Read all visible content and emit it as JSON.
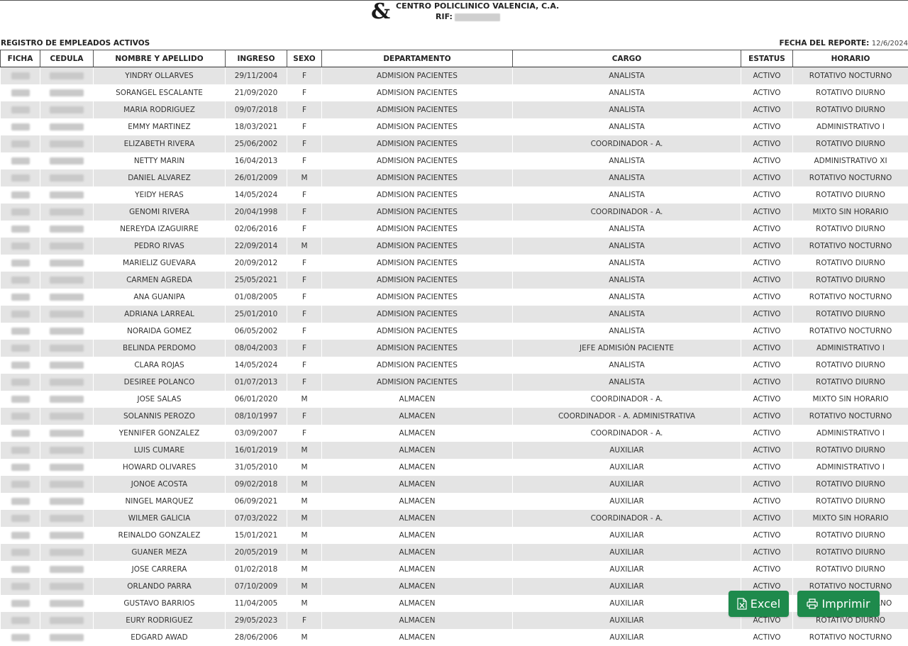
{
  "header": {
    "company": "CENTRO POLICLINICO VALENCIA, C.A.",
    "rif_label": "RIF:",
    "subtitle": "REGISTRO DE EMPLEADOS ACTIVOS",
    "report_date_label": "FECHA DEL REPORTE:",
    "report_date_value": "12/6/2024"
  },
  "table": {
    "columns": [
      "FICHA",
      "CEDULA",
      "NOMBRE Y APELLIDO",
      "INGRESO",
      "SEXO",
      "DEPARTAMENTO",
      "CARGO",
      "ESTATUS",
      "HORARIO"
    ],
    "rows": [
      {
        "nombre": "YINDRY OLLARVES",
        "ingreso": "29/11/2004",
        "sexo": "F",
        "departamento": "ADMISION PACIENTES",
        "cargo": "ANALISTA",
        "estatus": "ACTIVO",
        "horario": "ROTATIVO NOCTURNO"
      },
      {
        "nombre": "SORANGEL ESCALANTE",
        "ingreso": "21/09/2020",
        "sexo": "F",
        "departamento": "ADMISION PACIENTES",
        "cargo": "ANALISTA",
        "estatus": "ACTIVO",
        "horario": "ROTATIVO DIURNO"
      },
      {
        "nombre": "MARIA RODRIGUEZ",
        "ingreso": "09/07/2018",
        "sexo": "F",
        "departamento": "ADMISION PACIENTES",
        "cargo": "ANALISTA",
        "estatus": "ACTIVO",
        "horario": "ROTATIVO DIURNO"
      },
      {
        "nombre": "EMMY MARTINEZ",
        "ingreso": "18/03/2021",
        "sexo": "F",
        "departamento": "ADMISION PACIENTES",
        "cargo": "ANALISTA",
        "estatus": "ACTIVO",
        "horario": "ADMINISTRATIVO I"
      },
      {
        "nombre": "ELIZABETH RIVERA",
        "ingreso": "25/06/2002",
        "sexo": "F",
        "departamento": "ADMISION PACIENTES",
        "cargo": "COORDINADOR - A.",
        "estatus": "ACTIVO",
        "horario": "ROTATIVO DIURNO"
      },
      {
        "nombre": "NETTY MARIN",
        "ingreso": "16/04/2013",
        "sexo": "F",
        "departamento": "ADMISION PACIENTES",
        "cargo": "ANALISTA",
        "estatus": "ACTIVO",
        "horario": "ADMINISTRATIVO XI"
      },
      {
        "nombre": "DANIEL ALVAREZ",
        "ingreso": "26/01/2009",
        "sexo": "M",
        "departamento": "ADMISION PACIENTES",
        "cargo": "ANALISTA",
        "estatus": "ACTIVO",
        "horario": "ROTATIVO NOCTURNO"
      },
      {
        "nombre": "YEIDY HERAS",
        "ingreso": "14/05/2024",
        "sexo": "F",
        "departamento": "ADMISION PACIENTES",
        "cargo": "ANALISTA",
        "estatus": "ACTIVO",
        "horario": "ROTATIVO DIURNO"
      },
      {
        "nombre": "GENOMI RIVERA",
        "ingreso": "20/04/1998",
        "sexo": "F",
        "departamento": "ADMISION PACIENTES",
        "cargo": "COORDINADOR - A.",
        "estatus": "ACTIVO",
        "horario": "MIXTO SIN HORARIO"
      },
      {
        "nombre": "NEREYDA IZAGUIRRE",
        "ingreso": "02/06/2016",
        "sexo": "F",
        "departamento": "ADMISION PACIENTES",
        "cargo": "ANALISTA",
        "estatus": "ACTIVO",
        "horario": "ROTATIVO DIURNO"
      },
      {
        "nombre": "PEDRO RIVAS",
        "ingreso": "22/09/2014",
        "sexo": "M",
        "departamento": "ADMISION PACIENTES",
        "cargo": "ANALISTA",
        "estatus": "ACTIVO",
        "horario": "ROTATIVO NOCTURNO"
      },
      {
        "nombre": "MARIELIZ GUEVARA",
        "ingreso": "20/09/2012",
        "sexo": "F",
        "departamento": "ADMISION PACIENTES",
        "cargo": "ANALISTA",
        "estatus": "ACTIVO",
        "horario": "ROTATIVO DIURNO"
      },
      {
        "nombre": "CARMEN AGREDA",
        "ingreso": "25/05/2021",
        "sexo": "F",
        "departamento": "ADMISION PACIENTES",
        "cargo": "ANALISTA",
        "estatus": "ACTIVO",
        "horario": "ROTATIVO DIURNO"
      },
      {
        "nombre": "ANA GUANIPA",
        "ingreso": "01/08/2005",
        "sexo": "F",
        "departamento": "ADMISION PACIENTES",
        "cargo": "ANALISTA",
        "estatus": "ACTIVO",
        "horario": "ROTATIVO NOCTURNO"
      },
      {
        "nombre": "ADRIANA LARREAL",
        "ingreso": "25/01/2010",
        "sexo": "F",
        "departamento": "ADMISION PACIENTES",
        "cargo": "ANALISTA",
        "estatus": "ACTIVO",
        "horario": "ROTATIVO DIURNO"
      },
      {
        "nombre": "NORAIDA GOMEZ",
        "ingreso": "06/05/2002",
        "sexo": "F",
        "departamento": "ADMISION PACIENTES",
        "cargo": "ANALISTA",
        "estatus": "ACTIVO",
        "horario": "ROTATIVO NOCTURNO"
      },
      {
        "nombre": "BELINDA PERDOMO",
        "ingreso": "08/04/2003",
        "sexo": "F",
        "departamento": "ADMISION PACIENTES",
        "cargo": "JEFE ADMISIÓN PACIENTE",
        "estatus": "ACTIVO",
        "horario": "ADMINISTRATIVO I"
      },
      {
        "nombre": "CLARA ROJAS",
        "ingreso": "14/05/2024",
        "sexo": "F",
        "departamento": "ADMISION PACIENTES",
        "cargo": "ANALISTA",
        "estatus": "ACTIVO",
        "horario": "ROTATIVO DIURNO"
      },
      {
        "nombre": "DESIREE POLANCO",
        "ingreso": "01/07/2013",
        "sexo": "F",
        "departamento": "ADMISION PACIENTES",
        "cargo": "ANALISTA",
        "estatus": "ACTIVO",
        "horario": "ROTATIVO DIURNO"
      },
      {
        "nombre": "JOSE SALAS",
        "ingreso": "06/01/2020",
        "sexo": "M",
        "departamento": "ALMACEN",
        "cargo": "COORDINADOR - A.",
        "estatus": "ACTIVO",
        "horario": "MIXTO SIN HORARIO"
      },
      {
        "nombre": "SOLANNIS PEROZO",
        "ingreso": "08/10/1997",
        "sexo": "F",
        "departamento": "ALMACEN",
        "cargo": "COORDINADOR - A. ADMINISTRATIVA",
        "estatus": "ACTIVO",
        "horario": "ROTATIVO NOCTURNO"
      },
      {
        "nombre": "YENNIFER GONZALEZ",
        "ingreso": "03/09/2007",
        "sexo": "F",
        "departamento": "ALMACEN",
        "cargo": "COORDINADOR - A.",
        "estatus": "ACTIVO",
        "horario": "ADMINISTRATIVO I"
      },
      {
        "nombre": "LUIS CUMARE",
        "ingreso": "16/01/2019",
        "sexo": "M",
        "departamento": "ALMACEN",
        "cargo": "AUXILIAR",
        "estatus": "ACTIVO",
        "horario": "ROTATIVO DIURNO"
      },
      {
        "nombre": "HOWARD OLIVARES",
        "ingreso": "31/05/2010",
        "sexo": "M",
        "departamento": "ALMACEN",
        "cargo": "AUXILIAR",
        "estatus": "ACTIVO",
        "horario": "ADMINISTRATIVO I"
      },
      {
        "nombre": "JONOE ACOSTA",
        "ingreso": "09/02/2018",
        "sexo": "M",
        "departamento": "ALMACEN",
        "cargo": "AUXILIAR",
        "estatus": "ACTIVO",
        "horario": "ROTATIVO DIURNO"
      },
      {
        "nombre": "NINGEL MARQUEZ",
        "ingreso": "06/09/2021",
        "sexo": "M",
        "departamento": "ALMACEN",
        "cargo": "AUXILIAR",
        "estatus": "ACTIVO",
        "horario": "ROTATIVO DIURNO"
      },
      {
        "nombre": "WILMER GALICIA",
        "ingreso": "07/03/2022",
        "sexo": "M",
        "departamento": "ALMACEN",
        "cargo": "COORDINADOR - A.",
        "estatus": "ACTIVO",
        "horario": "MIXTO SIN HORARIO"
      },
      {
        "nombre": "REINALDO GONZALEZ",
        "ingreso": "15/01/2021",
        "sexo": "M",
        "departamento": "ALMACEN",
        "cargo": "AUXILIAR",
        "estatus": "ACTIVO",
        "horario": "ROTATIVO DIURNO"
      },
      {
        "nombre": "GUANER MEZA",
        "ingreso": "20/05/2019",
        "sexo": "M",
        "departamento": "ALMACEN",
        "cargo": "AUXILIAR",
        "estatus": "ACTIVO",
        "horario": "ROTATIVO DIURNO"
      },
      {
        "nombre": "JOSE CARRERA",
        "ingreso": "01/02/2018",
        "sexo": "M",
        "departamento": "ALMACEN",
        "cargo": "AUXILIAR",
        "estatus": "ACTIVO",
        "horario": "ROTATIVO DIURNO"
      },
      {
        "nombre": "ORLANDO PARRA",
        "ingreso": "07/10/2009",
        "sexo": "M",
        "departamento": "ALMACEN",
        "cargo": "AUXILIAR",
        "estatus": "ACTIVO",
        "horario": "ROTATIVO NOCTURNO"
      },
      {
        "nombre": "GUSTAVO BARRIOS",
        "ingreso": "11/04/2005",
        "sexo": "M",
        "departamento": "ALMACEN",
        "cargo": "AUXILIAR",
        "estatus": "ACTIVO",
        "horario": "ROTATIVO NOCTURNO"
      },
      {
        "nombre": "EURY RODRIGUEZ",
        "ingreso": "29/05/2023",
        "sexo": "F",
        "departamento": "ALMACEN",
        "cargo": "AUXILIAR",
        "estatus": "ACTIVO",
        "horario": "ROTATIVO DIURNO"
      },
      {
        "nombre": "EDGARD AWAD",
        "ingreso": "28/06/2006",
        "sexo": "M",
        "departamento": "ALMACEN",
        "cargo": "AUXILIAR",
        "estatus": "ACTIVO",
        "horario": "ROTATIVO NOCTURNO"
      }
    ]
  },
  "buttons": {
    "excel_label": "Excel",
    "print_label": "Imprimir"
  },
  "colors": {
    "button_green": "#1e8a4c",
    "row_stripe": "#e4e4e4"
  },
  "icons": {
    "logo": "ampersand-logo",
    "excel": "excel-file-icon",
    "print": "printer-icon"
  }
}
